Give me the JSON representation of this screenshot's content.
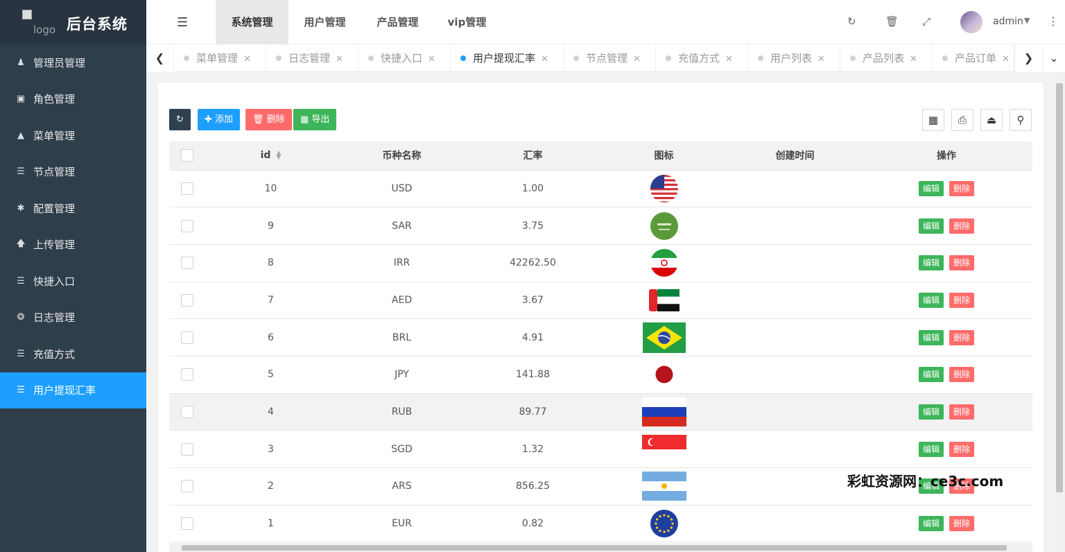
{
  "sidebar": {
    "logo_alt": "logo",
    "title": "后台系统",
    "items": [
      {
        "label": "管理员管理",
        "icon": "user-icon"
      },
      {
        "label": "角色管理",
        "icon": "role-icon"
      },
      {
        "label": "菜单管理",
        "icon": "tree-icon"
      },
      {
        "label": "节点管理",
        "icon": "list-icon"
      },
      {
        "label": "配置管理",
        "icon": "asterisk-icon"
      },
      {
        "label": "上传管理",
        "icon": "upload-arrow-icon"
      },
      {
        "label": "快捷入口",
        "icon": "list-icon"
      },
      {
        "label": "日志管理",
        "icon": "log-icon"
      },
      {
        "label": "充值方式",
        "icon": "list-icon"
      },
      {
        "label": "用户提现汇率",
        "icon": "list-icon",
        "active": true
      }
    ]
  },
  "header": {
    "tabs": [
      "系统管理",
      "用户管理",
      "产品管理",
      "vip管理"
    ],
    "active_tab": "系统管理",
    "user_name": "admin"
  },
  "page_tabs": [
    {
      "label": "菜单管理"
    },
    {
      "label": "日志管理"
    },
    {
      "label": "快捷入口"
    },
    {
      "label": "用户提现汇率",
      "active": true
    },
    {
      "label": "节点管理"
    },
    {
      "label": "充值方式"
    },
    {
      "label": "用户列表"
    },
    {
      "label": "产品列表"
    },
    {
      "label": "产品订单"
    }
  ],
  "toolbar": {
    "add_label": "添加",
    "delete_label": "删除",
    "export_label": "导出"
  },
  "table": {
    "columns": [
      "id",
      "币种名称",
      "汇率",
      "图标",
      "创建时间",
      "操作"
    ],
    "edit_label": "编辑",
    "delete_label": "删除",
    "rows": [
      {
        "id": "10",
        "currency": "USD",
        "rate": "1.00",
        "flag": "us-flag-icon",
        "created": ""
      },
      {
        "id": "9",
        "currency": "SAR",
        "rate": "3.75",
        "flag": "saudi-flag-icon",
        "created": ""
      },
      {
        "id": "8",
        "currency": "IRR",
        "rate": "42262.50",
        "flag": "iran-flag-icon",
        "created": ""
      },
      {
        "id": "7",
        "currency": "AED",
        "rate": "3.67",
        "flag": "uae-flag-icon",
        "created": ""
      },
      {
        "id": "6",
        "currency": "BRL",
        "rate": "4.91",
        "flag": "brazil-flag-icon",
        "created": ""
      },
      {
        "id": "5",
        "currency": "JPY",
        "rate": "141.88",
        "flag": "japan-flag-icon",
        "created": ""
      },
      {
        "id": "4",
        "currency": "RUB",
        "rate": "89.77",
        "flag": "russia-flag-icon",
        "created": ""
      },
      {
        "id": "3",
        "currency": "SGD",
        "rate": "1.32",
        "flag": "singapore-flag-icon",
        "created": ""
      },
      {
        "id": "2",
        "currency": "ARS",
        "rate": "856.25",
        "flag": "argentina-flag-icon",
        "created": ""
      },
      {
        "id": "1",
        "currency": "EUR",
        "rate": "0.82",
        "flag": "eu-flag-icon",
        "created": ""
      }
    ]
  },
  "watermark": "彩虹资源网：ce3c.com",
  "colors": {
    "sidebar_bg": "#2f3e4b",
    "accent": "#1e9fff",
    "danger": "#ff6b6b",
    "success": "#3db55a"
  }
}
